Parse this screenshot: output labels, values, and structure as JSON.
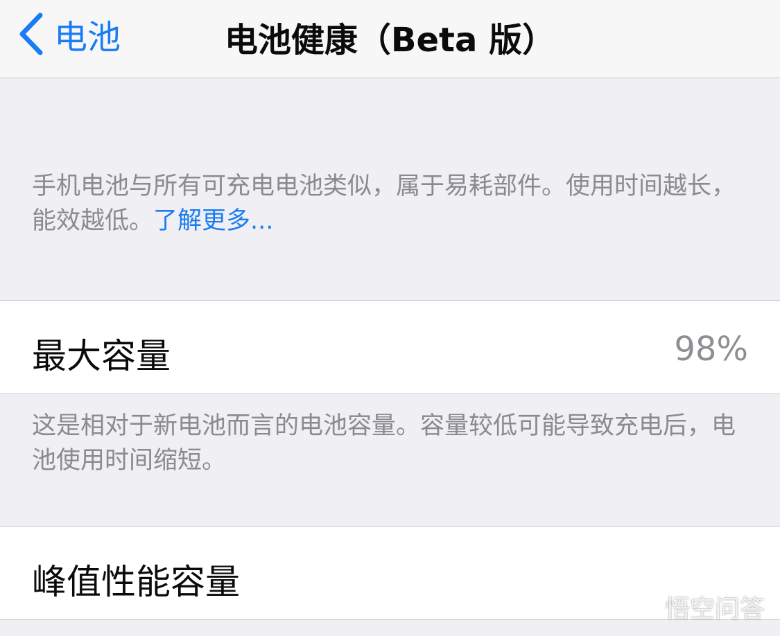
{
  "nav": {
    "back_label": "电池",
    "title": "电池健康（Beta 版）"
  },
  "intro": {
    "text": "手机电池与所有可充电电池类似，属于易耗部件。使用时间越长，能效越低。",
    "link": "了解更多..."
  },
  "max_capacity": {
    "label": "最大容量",
    "value": "98%",
    "footnote": "这是相对于新电池而言的电池容量。容量较低可能导致充电后，电池使用时间缩短。"
  },
  "peak_performance": {
    "label": "峰值性能容量"
  },
  "watermark": {
    "text": "悟空问答"
  },
  "colors": {
    "accent": "#1a7cf3",
    "background": "#efeff4",
    "secondary_text": "#8a8a8f"
  }
}
